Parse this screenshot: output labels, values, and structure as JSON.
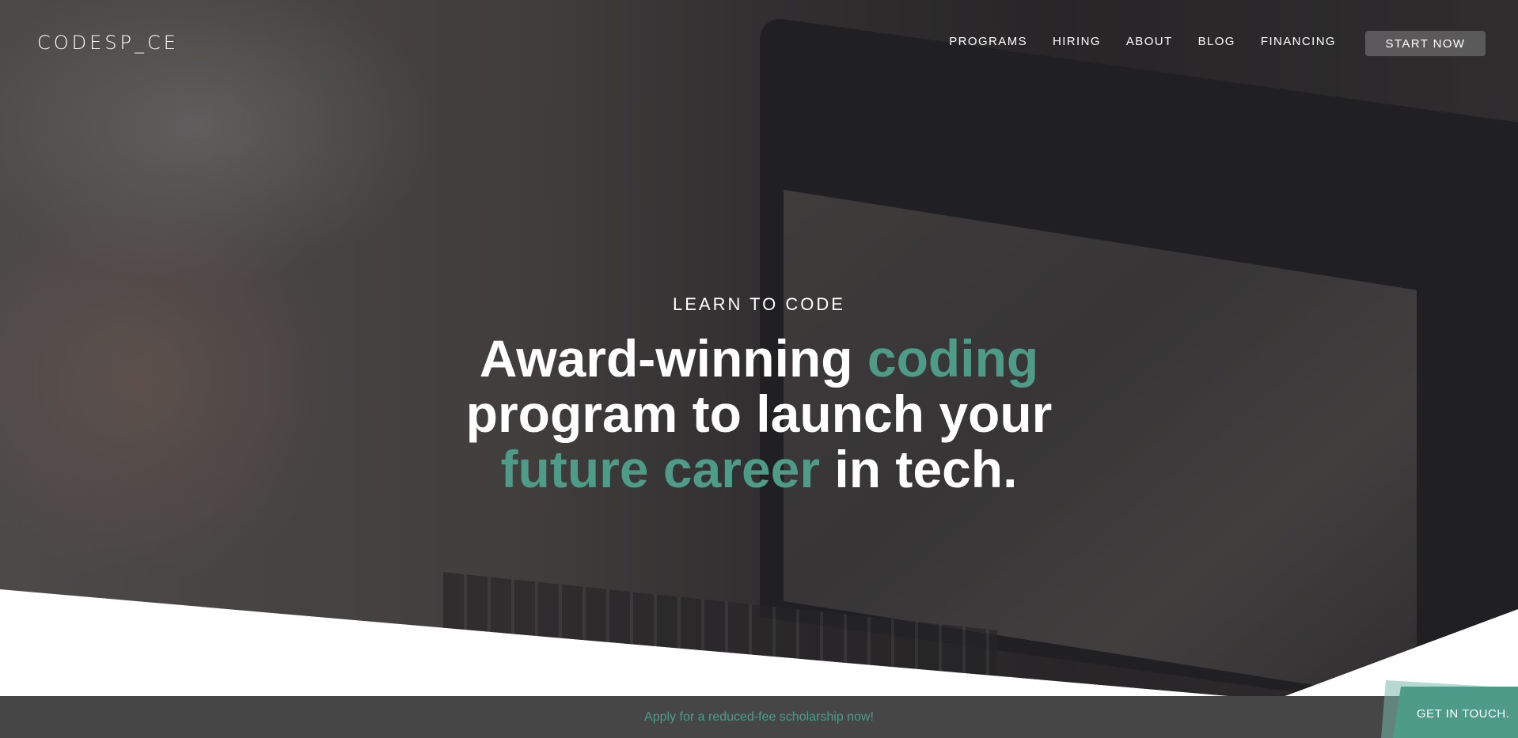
{
  "brand": {
    "logo_text": "CODESP_CE"
  },
  "nav": {
    "items": [
      "PROGRAMS",
      "HIRING",
      "ABOUT",
      "BLOG",
      "FINANCING"
    ],
    "cta_label": "START NOW"
  },
  "hero": {
    "eyebrow": "LEARN TO CODE",
    "headline": {
      "part1": "Award-winning ",
      "accent1": "coding",
      "part2": "program to launch your",
      "accent2": "future career",
      "part3": " in tech."
    }
  },
  "banner": {
    "text": "Apply for a reduced-fee scholarship now!"
  },
  "contact": {
    "label": "GET IN TOUCH."
  },
  "colors": {
    "accent": "#4e9c88",
    "banner_bg": "#464646"
  }
}
